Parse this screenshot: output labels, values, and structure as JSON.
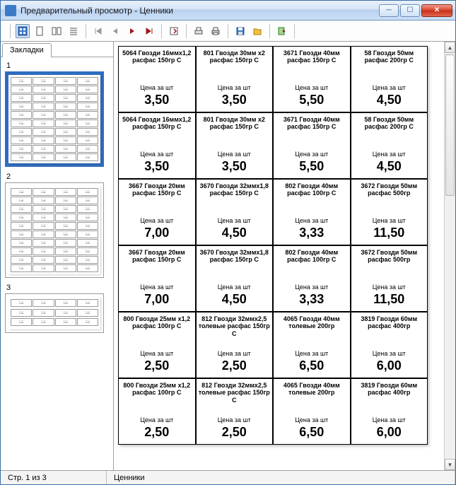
{
  "window": {
    "title": "Предварительный просмотр  -  Ценники"
  },
  "sidebar": {
    "tab_label": "Закладки",
    "pages": [
      "1",
      "2",
      "3"
    ]
  },
  "unit_label": "Цена за шт",
  "tags": [
    {
      "desc": "5064  Гвозди 16ммх1,2 расфас 150гр С",
      "price": "3,50"
    },
    {
      "desc": "801  Гвозди  30мм х2 расфас 150гр С",
      "price": "3,50"
    },
    {
      "desc": "3671  Гвозди  40мм расфас  150гр С",
      "price": "5,50"
    },
    {
      "desc": "58  Гвозди  50мм расфас 200гр С",
      "price": "4,50"
    },
    {
      "desc": "5064  Гвозди 16ммх1,2 расфас 150гр С",
      "price": "3,50"
    },
    {
      "desc": "801  Гвозди  30мм х2 расфас 150гр С",
      "price": "3,50"
    },
    {
      "desc": "3671  Гвозди  40мм расфас  150гр С",
      "price": "5,50"
    },
    {
      "desc": "58  Гвозди  50мм расфас 200гр С",
      "price": "4,50"
    },
    {
      "desc": "3667  Гвозди  20мм расфас  150гр С",
      "price": "7,00"
    },
    {
      "desc": "3670  Гвозди 32ммх1,8 расфас 150гр С",
      "price": "4,50"
    },
    {
      "desc": "802  Гвозди  40мм расфас 100гр С",
      "price": "3,33"
    },
    {
      "desc": "3672  Гвозди  50мм расфас 500гр",
      "price": "11,50"
    },
    {
      "desc": "3667  Гвозди  20мм расфас  150гр С",
      "price": "7,00"
    },
    {
      "desc": "3670  Гвозди 32ммх1,8 расфас 150гр С",
      "price": "4,50"
    },
    {
      "desc": "802  Гвозди  40мм расфас 100гр С",
      "price": "3,33"
    },
    {
      "desc": "3672  Гвозди  50мм расфас 500гр",
      "price": "11,50"
    },
    {
      "desc": "800  Гвозди  25мм х1,2 расфас  100гр С",
      "price": "2,50"
    },
    {
      "desc": "812  Гвозди 32ммх2,5 толевые расфас 150гр С",
      "price": "2,50"
    },
    {
      "desc": "4065  Гвозди  40мм толевые 200гр",
      "price": "6,50"
    },
    {
      "desc": "3819  Гвозди  60мм расфас 400гр",
      "price": "6,00"
    },
    {
      "desc": "800  Гвозди  25мм х1,2 расфас  100гр С",
      "price": "2,50"
    },
    {
      "desc": "812  Гвозди 32ммх2,5 толевые расфас 150гр С",
      "price": "2,50"
    },
    {
      "desc": "4065  Гвозди  40мм толевые 200гр",
      "price": "6,50"
    },
    {
      "desc": "3819  Гвозди  60мм расфас 400гр",
      "price": "6,00"
    }
  ],
  "status": {
    "page": "Стр. 1 из 3",
    "doc": "Ценники"
  }
}
